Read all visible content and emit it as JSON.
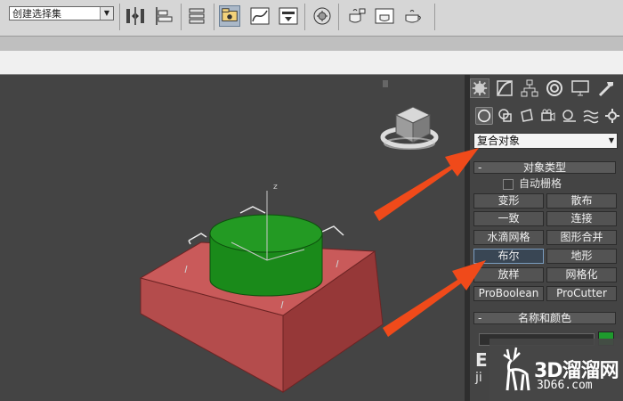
{
  "toolbar": {
    "selection_set": {
      "value": "创建选择集"
    }
  },
  "command_panel": {
    "category_dropdown": {
      "value": "复合对象"
    },
    "object_type_rollout": {
      "title": "对象类型",
      "collapse_symbol": "-",
      "autogrid_label": "自动栅格",
      "buttons": [
        {
          "label": "变形",
          "pressed": false
        },
        {
          "label": "散布",
          "pressed": false
        },
        {
          "label": "一致",
          "pressed": false
        },
        {
          "label": "连接",
          "pressed": false
        },
        {
          "label": "水滴网格",
          "pressed": false
        },
        {
          "label": "图形合并",
          "pressed": false
        },
        {
          "label": "布尔",
          "pressed": true
        },
        {
          "label": "地形",
          "pressed": false
        },
        {
          "label": "放样",
          "pressed": false
        },
        {
          "label": "网格化",
          "pressed": false
        },
        {
          "label": "ProBoolean",
          "pressed": false
        },
        {
          "label": "ProCutter",
          "pressed": false
        }
      ]
    },
    "name_color_rollout": {
      "title": "名称和颜色",
      "collapse_symbol": "-",
      "color": "#1e9a2d"
    },
    "obscured_text_1": "E",
    "obscured_text_2": "ji"
  },
  "viewport": {
    "box_color": "#b84a4a",
    "cylinder_color": "#1f8f1f",
    "axis_label_z": "z"
  },
  "annotation_arrow_color": "#f04a1a",
  "watermark": {
    "brand": "3D溜溜网",
    "url": "3D66.com"
  }
}
